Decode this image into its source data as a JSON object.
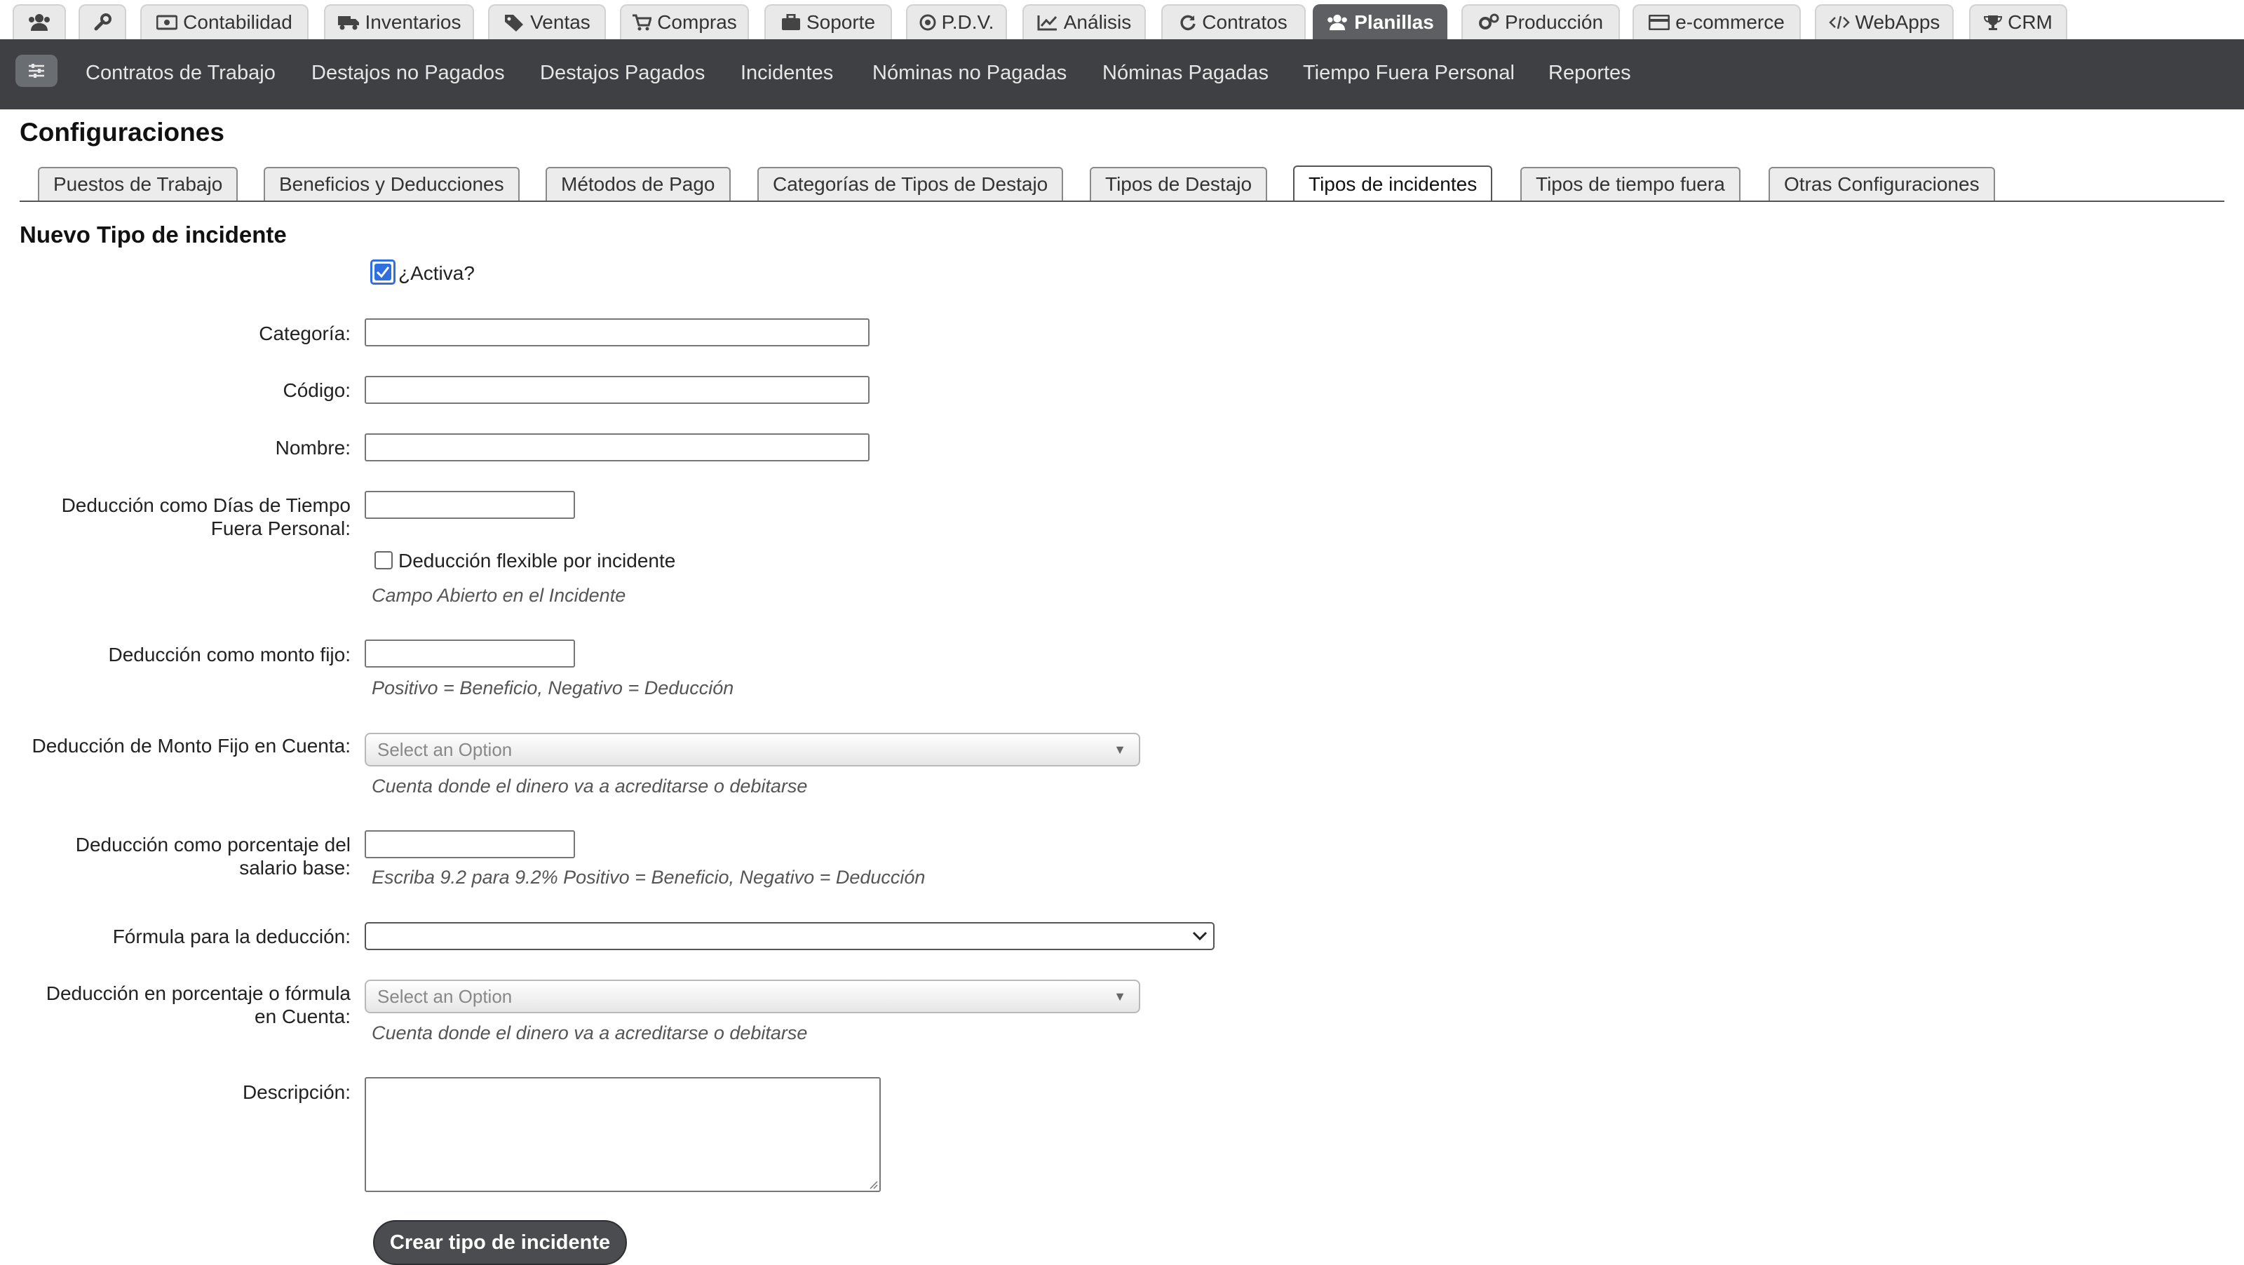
{
  "top_tabs": [
    {
      "label": "",
      "icon": "users-icon"
    },
    {
      "label": "",
      "icon": "wrench-icon"
    },
    {
      "label": "Contabilidad",
      "icon": "money-icon"
    },
    {
      "label": "Inventarios",
      "icon": "truck-icon"
    },
    {
      "label": "Ventas",
      "icon": "tag-icon"
    },
    {
      "label": "Compras",
      "icon": "cart-icon"
    },
    {
      "label": "Soporte",
      "icon": "briefcase-icon"
    },
    {
      "label": "P.D.V.",
      "icon": "pos-icon"
    },
    {
      "label": "Análisis",
      "icon": "chart-icon"
    },
    {
      "label": "Contratos",
      "icon": "refresh-icon"
    },
    {
      "label": "Planillas",
      "icon": "users-icon",
      "active": true
    },
    {
      "label": "Producción",
      "icon": "gears-icon"
    },
    {
      "label": "e-commerce",
      "icon": "card-icon"
    },
    {
      "label": "WebApps",
      "icon": "code-icon"
    },
    {
      "label": "CRM",
      "icon": "trophy-icon"
    }
  ],
  "subnav": {
    "items": [
      "Contratos de Trabajo",
      "Destajos no Pagados",
      "Destajos Pagados",
      "Incidentes",
      "Nóminas no Pagadas",
      "Nóminas Pagadas",
      "Tiempo Fuera Personal",
      "Reportes"
    ]
  },
  "page": {
    "title": "Configuraciones",
    "config_tabs": [
      "Puestos de Trabajo",
      "Beneficios y Deducciones",
      "Métodos de Pago",
      "Categorías de Tipos de Destajo",
      "Tipos de Destajo",
      "Tipos de incidentes",
      "Tipos de tiempo fuera",
      "Otras Configuraciones"
    ],
    "active_config_tab": "Tipos de incidentes"
  },
  "form": {
    "title": "Nuevo Tipo de incidente",
    "active_label": "¿Activa?",
    "active_checked": true,
    "categoria_label": "Categoría:",
    "codigo_label": "Código:",
    "nombre_label": "Nombre:",
    "dias_label": "Deducción como Días de Tiempo Fuera Personal:",
    "flexible_label": "Deducción flexible por incidente",
    "flexible_checked": false,
    "flexible_hint": "Campo Abierto en el Incidente",
    "monto_label": "Deducción como monto fijo:",
    "monto_hint": "Positivo = Beneficio, Negativo = Deducción",
    "cuenta_fijo_label": "Deducción de Monto Fijo en Cuenta:",
    "cuenta_fijo_placeholder": "Select an Option",
    "cuenta_fijo_hint": "Cuenta donde el dinero va a acreditarse o debitarse",
    "porcentaje_label": "Deducción como porcentaje del salario base:",
    "porcentaje_hint": "Escriba 9.2 para 9.2% Positivo = Beneficio, Negativo = Deducción",
    "formula_label": "Fórmula para la deducción:",
    "cuenta_pct_label": "Deducción en porcentaje o fórmula en Cuenta:",
    "cuenta_pct_placeholder": "Select an Option",
    "cuenta_pct_hint": "Cuenta donde el dinero va a acreditarse o debitarse",
    "descripcion_label": "Descripción:",
    "submit_label": "Crear tipo de incidente"
  }
}
